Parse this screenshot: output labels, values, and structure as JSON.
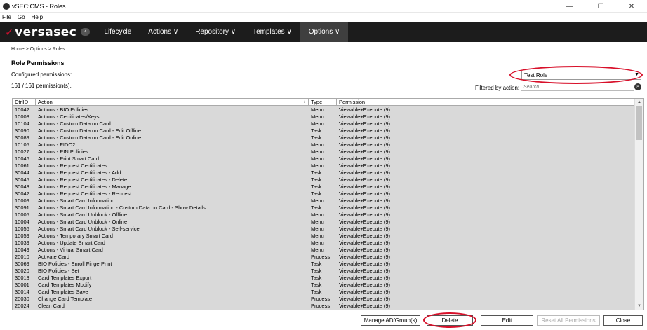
{
  "window": {
    "title": "vSEC:CMS -  Roles",
    "controls": [
      "—",
      "☐",
      "✕"
    ]
  },
  "menu": [
    "File",
    "Go",
    "Help"
  ],
  "nav": {
    "logo": "versasec",
    "badge": "4",
    "items": [
      "Lifecycle",
      "Actions ∨",
      "Repository ∨",
      "Templates ∨",
      "Options ∨"
    ],
    "active_index": 4
  },
  "breadcrumb": "Home > Options > Roles",
  "page": {
    "title": "Role Permissions",
    "configured_label": "Configured permissions:",
    "count": "161 / 161 permission(s).",
    "role_value": "Test Role",
    "filter_label": "Filtered by action:",
    "search_placeholder": "Search"
  },
  "table": {
    "headers": [
      "CtrlID",
      "Action",
      "Type",
      "Permission"
    ],
    "rows": [
      [
        "10042",
        "Actions - BIO Policies",
        "Menu",
        "Viewable+Execute (9)"
      ],
      [
        "10008",
        "Actions - Certificates/Keys",
        "Menu",
        "Viewable+Execute (9)"
      ],
      [
        "10104",
        "Actions - Custom Data on Card",
        "Menu",
        "Viewable+Execute (9)"
      ],
      [
        "30090",
        "Actions - Custom Data on Card - Edit Offline",
        "Task",
        "Viewable+Execute (9)"
      ],
      [
        "30089",
        "Actions - Custom Data on Card - Edit Online",
        "Task",
        "Viewable+Execute (9)"
      ],
      [
        "10105",
        "Actions - FIDO2",
        "Menu",
        "Viewable+Execute (9)"
      ],
      [
        "10027",
        "Actions - PIN Policies",
        "Menu",
        "Viewable+Execute (9)"
      ],
      [
        "10046",
        "Actions - Print Smart Card",
        "Menu",
        "Viewable+Execute (9)"
      ],
      [
        "10061",
        "Actions - Request Certificates",
        "Menu",
        "Viewable+Execute (9)"
      ],
      [
        "30044",
        "Actions - Request Certificates - Add",
        "Task",
        "Viewable+Execute (9)"
      ],
      [
        "30045",
        "Actions - Request Certificates - Delete",
        "Task",
        "Viewable+Execute (9)"
      ],
      [
        "30043",
        "Actions - Request Certificates - Manage",
        "Task",
        "Viewable+Execute (9)"
      ],
      [
        "30042",
        "Actions - Request Certificates - Request",
        "Task",
        "Viewable+Execute (9)"
      ],
      [
        "10009",
        "Actions - Smart Card Information",
        "Menu",
        "Viewable+Execute (9)"
      ],
      [
        "30091",
        "Actions - Smart Card Information - Custom Data on Card - Show Details",
        "Task",
        "Viewable+Execute (9)"
      ],
      [
        "10005",
        "Actions - Smart Card Unblock - Offline",
        "Menu",
        "Viewable+Execute (9)"
      ],
      [
        "10004",
        "Actions - Smart Card Unblock - Online",
        "Menu",
        "Viewable+Execute (9)"
      ],
      [
        "10056",
        "Actions - Smart Card Unblock - Self-service",
        "Menu",
        "Viewable+Execute (9)"
      ],
      [
        "10059",
        "Actions - Temporary Smart Card",
        "Menu",
        "Viewable+Execute (9)"
      ],
      [
        "10039",
        "Actions - Update Smart Card",
        "Menu",
        "Viewable+Execute (9)"
      ],
      [
        "10049",
        "Actions - Virtual Smart Card",
        "Menu",
        "Viewable+Execute (9)"
      ],
      [
        "20010",
        "Activate Card",
        "Process",
        "Viewable+Execute (9)"
      ],
      [
        "30069",
        "BIO Policies - Enroll FingerPrint",
        "Task",
        "Viewable+Execute (9)"
      ],
      [
        "30020",
        "BIO Policies - Set",
        "Task",
        "Viewable+Execute (9)"
      ],
      [
        "30013",
        "Card Templates Export",
        "Task",
        "Viewable+Execute (9)"
      ],
      [
        "30001",
        "Card Templates Modify",
        "Task",
        "Viewable+Execute (9)"
      ],
      [
        "30014",
        "Card Templates Save",
        "Task",
        "Viewable+Execute (9)"
      ],
      [
        "20030",
        "Change Card Template",
        "Process",
        "Viewable+Execute (9)"
      ],
      [
        "20024",
        "Clean Card",
        "Process",
        "Viewable+Execute (9)"
      ]
    ]
  },
  "buttons": {
    "manage": "Manage AD/Group(s)",
    "delete": "Delete",
    "edit": "Edit",
    "reset": "Reset All Permissions",
    "close": "Close"
  },
  "colors": {
    "nav_bg": "#1c1c1c",
    "annotation": "#d8102a",
    "row_bg": "#d9d9d9"
  }
}
